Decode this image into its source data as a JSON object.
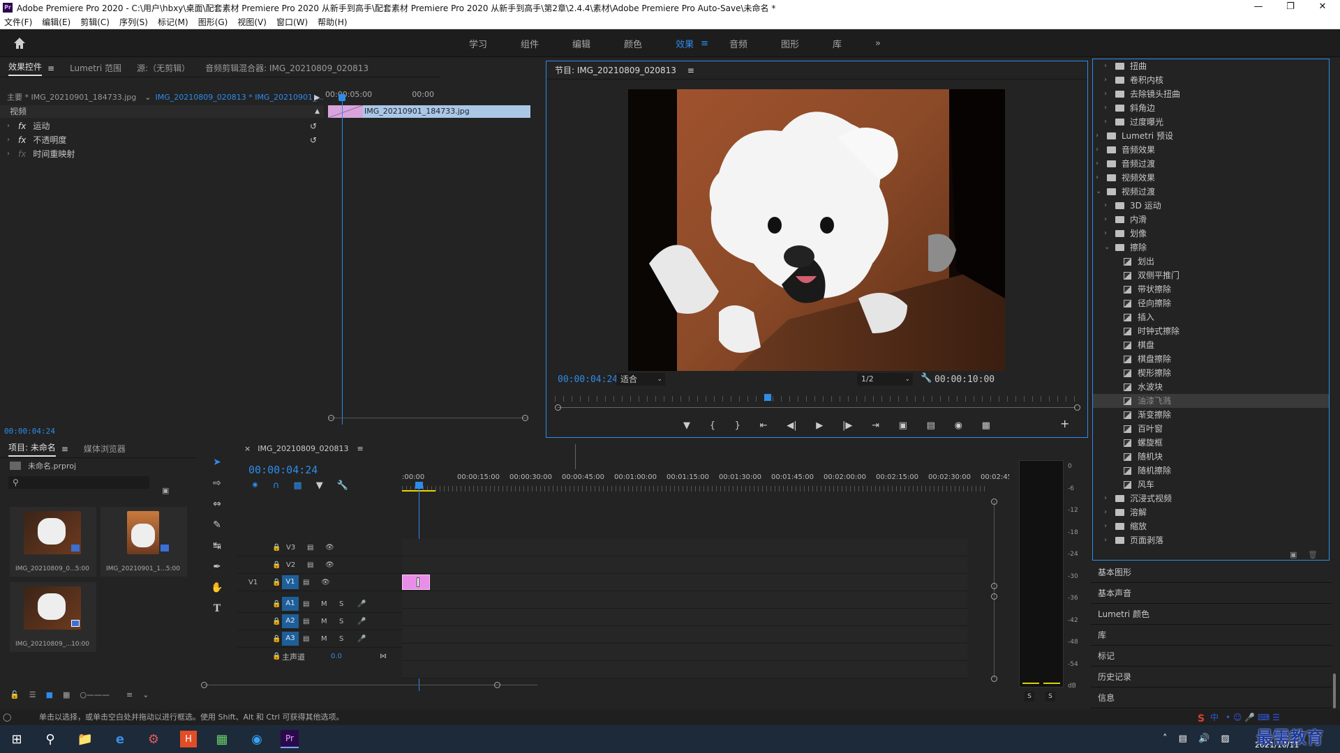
{
  "titlebar": {
    "app_abbr": "Pr",
    "title": "Adobe Premiere Pro 2020 - C:\\用户\\hbxy\\桌面\\配套素材 Premiere Pro 2020 从新手到高手\\配套素材 Premiere Pro 2020 从新手到高手\\第2章\\2.4.4\\素材\\Adobe Premiere Pro Auto-Save\\未命名 *"
  },
  "menu": [
    "文件(F)",
    "编辑(E)",
    "剪辑(C)",
    "序列(S)",
    "标记(M)",
    "图形(G)",
    "视图(V)",
    "窗口(W)",
    "帮助(H)"
  ],
  "workspaces": {
    "tabs": [
      "学习",
      "组件",
      "编辑",
      "颜色",
      "效果",
      "音频",
      "图形",
      "库"
    ],
    "active": "效果",
    "more": "»"
  },
  "effect_controls": {
    "tabs": [
      "效果控件",
      "Lumetri 范围",
      "源:（无剪辑）",
      "音频剪辑混合器: IMG_20210809_020813"
    ],
    "master": "主要 * IMG_20210901_184733.jpg",
    "sequence": "IMG_20210809_020813 * IMG_20210901_...",
    "ruler_left": "00:00:05:00",
    "ruler_right": "00:00",
    "clip": "IMG_20210901_184733.jpg",
    "section": "视频",
    "effects": [
      "运动",
      "不透明度",
      "时间重映射"
    ],
    "timecode": "00:00:04:24"
  },
  "program": {
    "title": "节目: IMG_20210809_020813",
    "timecode": "00:00:04:24",
    "fit": "适合",
    "resolution": "1/2",
    "duration": "00:00:10:00",
    "playhead_fraction": 0.5
  },
  "effects_tree": [
    {
      "label": "扭曲",
      "type": "folder",
      "indent": 1
    },
    {
      "label": "卷积内核",
      "type": "folder",
      "indent": 1
    },
    {
      "label": "去除镜头扭曲",
      "type": "folder",
      "indent": 1
    },
    {
      "label": "斜角边",
      "type": "folder",
      "indent": 1
    },
    {
      "label": "过度曝光",
      "type": "folder",
      "indent": 1
    },
    {
      "label": "Lumetri 预设",
      "type": "folder",
      "indent": 0
    },
    {
      "label": "音频效果",
      "type": "folder",
      "indent": 0
    },
    {
      "label": "音频过渡",
      "type": "folder",
      "indent": 0
    },
    {
      "label": "视频效果",
      "type": "folder",
      "indent": 0
    },
    {
      "label": "视频过渡",
      "type": "folder",
      "indent": 0,
      "open": true
    },
    {
      "label": "3D 运动",
      "type": "folder",
      "indent": 1
    },
    {
      "label": "内滑",
      "type": "folder",
      "indent": 1
    },
    {
      "label": "划像",
      "type": "folder",
      "indent": 1
    },
    {
      "label": "擦除",
      "type": "folder",
      "indent": 1,
      "open": true
    },
    {
      "label": "划出",
      "type": "fx",
      "indent": 2
    },
    {
      "label": "双侧平推门",
      "type": "fx",
      "indent": 2
    },
    {
      "label": "带状擦除",
      "type": "fx",
      "indent": 2
    },
    {
      "label": "径向擦除",
      "type": "fx",
      "indent": 2
    },
    {
      "label": "插入",
      "type": "fx",
      "indent": 2
    },
    {
      "label": "时钟式擦除",
      "type": "fx",
      "indent": 2
    },
    {
      "label": "棋盘",
      "type": "fx",
      "indent": 2
    },
    {
      "label": "棋盘擦除",
      "type": "fx",
      "indent": 2
    },
    {
      "label": "楔形擦除",
      "type": "fx",
      "indent": 2
    },
    {
      "label": "水波块",
      "type": "fx",
      "indent": 2
    },
    {
      "label": "油漆飞溅",
      "type": "fx",
      "indent": 2,
      "selected": true
    },
    {
      "label": "渐变擦除",
      "type": "fx",
      "indent": 2
    },
    {
      "label": "百叶窗",
      "type": "fx",
      "indent": 2
    },
    {
      "label": "螺旋框",
      "type": "fx",
      "indent": 2
    },
    {
      "label": "随机块",
      "type": "fx",
      "indent": 2
    },
    {
      "label": "随机擦除",
      "type": "fx",
      "indent": 2
    },
    {
      "label": "风车",
      "type": "fx",
      "indent": 2
    },
    {
      "label": "沉浸式视频",
      "type": "folder",
      "indent": 1
    },
    {
      "label": "溶解",
      "type": "folder",
      "indent": 1
    },
    {
      "label": "缩放",
      "type": "folder",
      "indent": 1
    },
    {
      "label": "页面剥落",
      "type": "folder",
      "indent": 1
    }
  ],
  "right_panels": [
    "基本图形",
    "基本声音",
    "Lumetri 颜色",
    "库",
    "标记",
    "历史记录",
    "信息"
  ],
  "project": {
    "tabs": [
      "项目: 未命名",
      "媒体浏览器"
    ],
    "file": "未命名.prproj",
    "items": [
      {
        "name": "IMG_20210809_0...",
        "dur": "5:00"
      },
      {
        "name": "IMG_20210901_1...",
        "dur": "5:00"
      },
      {
        "name": "IMG_20210809_...",
        "dur": "10:00"
      }
    ]
  },
  "timeline": {
    "seq_name": "IMG_20210809_020813",
    "timecode": "00:00:04:24",
    "ruler": [
      ":00:00",
      "00:00:15:00",
      "00:00:30:00",
      "00:00:45:00",
      "00:01:00:00",
      "00:01:15:00",
      "00:01:30:00",
      "00:01:45:00",
      "00:02:00:00",
      "00:02:15:00",
      "00:02:30:00",
      "00:02:45:"
    ],
    "video_tracks": [
      "V3",
      "V2",
      "V1"
    ],
    "audio_tracks": [
      "A1",
      "A2",
      "A3"
    ],
    "v1_label": "V1",
    "master": "主声道",
    "master_val": "0.0",
    "m": "M",
    "s": "S"
  },
  "meter": {
    "scale": [
      "0",
      "-6",
      "-12",
      "-18",
      "-24",
      "-30",
      "-36",
      "-42",
      "-48",
      "-54",
      "dB"
    ],
    "s_left": "S",
    "s_right": "S"
  },
  "status": "单击以选择，或单击空白处并拖动以进行框选。使用 Shift、Alt 和 Ctrl 可获得其他选项。",
  "taskbar": {
    "time": "",
    "date": "2021/10/11",
    "watermark": "最需教育",
    "ime": "中"
  },
  "colors": {
    "accent": "#2d8ceb",
    "clip_pink": "#e88ee8",
    "clip_blue": "#aac8e6"
  }
}
